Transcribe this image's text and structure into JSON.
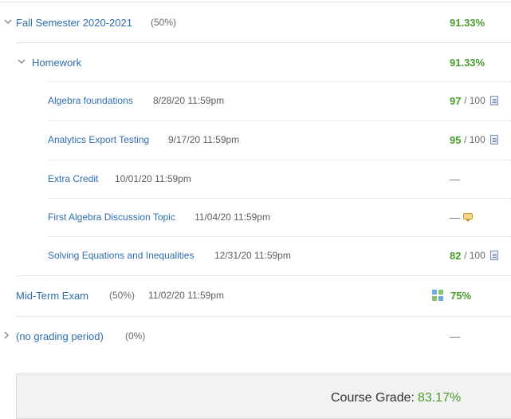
{
  "term": {
    "name": "Fall Semester 2020-2021",
    "weight": "(50%)",
    "grade": "91.33%"
  },
  "category": {
    "name": "Homework",
    "grade": "91.33%"
  },
  "items": [
    {
      "name": "Algebra foundations",
      "due": "8/28/20 11:59pm",
      "score": "97",
      "out_of": "/ 100",
      "icon": "document-icon"
    },
    {
      "name": "Analytics Export Testing",
      "due": "9/17/20 11:59pm",
      "score": "95",
      "out_of": "/ 100",
      "icon": "document-icon"
    },
    {
      "name": "Extra Credit",
      "due": "10/01/20 11:59pm",
      "score": "—",
      "icon": ""
    },
    {
      "name": "First Algebra Discussion Topic",
      "due": "11/04/20 11:59pm",
      "score": "—",
      "icon": "discussion-icon"
    },
    {
      "name": "Solving Equations and Inequalities",
      "due": "12/31/20 11:59pm",
      "score": "82",
      "out_of": "/ 100",
      "icon": "document-icon"
    }
  ],
  "midterm": {
    "name": "Mid-Term Exam",
    "weight": "(50%)",
    "due": "11/02/20 11:59pm",
    "grade": "75%",
    "icon": "assessment-grid-icon"
  },
  "no_period": {
    "name": "(no grading period)",
    "weight": "(0%)",
    "grade": "—"
  },
  "course_grade": {
    "label": "Course Grade:",
    "value": "83.17%"
  },
  "colors": {
    "link": "#2f6eae",
    "grade_green": "#4a9b2c",
    "divider": "#e4e4e4",
    "summary_bg": "#f2f2f2"
  }
}
